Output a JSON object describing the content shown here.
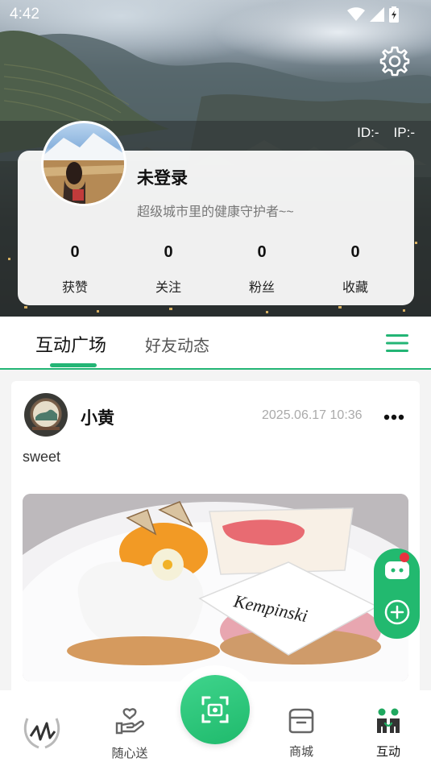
{
  "status_bar": {
    "time": "4:42"
  },
  "profile": {
    "id_label": "ID:-",
    "ip_label": "IP:-",
    "username": "未登录",
    "bio": "超级城市里的健康守护者~~",
    "stats": [
      {
        "value": "0",
        "label": "获赞"
      },
      {
        "value": "0",
        "label": "关注"
      },
      {
        "value": "0",
        "label": "粉丝"
      },
      {
        "value": "0",
        "label": "收藏"
      }
    ]
  },
  "tabs": [
    {
      "label": "互动广场",
      "active": true
    },
    {
      "label": "好友动态",
      "active": false
    }
  ],
  "post": {
    "author": "小黄",
    "timestamp": "2025.06.17 10:36",
    "text": "sweet",
    "image_caption_text": "Kempinski"
  },
  "bottom_nav": {
    "items": [
      {
        "label": "",
        "icon": "brand-logo-icon"
      },
      {
        "label": "随心送",
        "icon": "gift-hand-icon"
      },
      {
        "label": "",
        "icon": "scan-icon"
      },
      {
        "label": "商城",
        "icon": "shop-icon"
      },
      {
        "label": "互动",
        "icon": "people-icon",
        "active": true
      }
    ]
  },
  "colors": {
    "accent": "#23b575",
    "notification": "#e8323f",
    "card_bg": "#ffffff"
  }
}
